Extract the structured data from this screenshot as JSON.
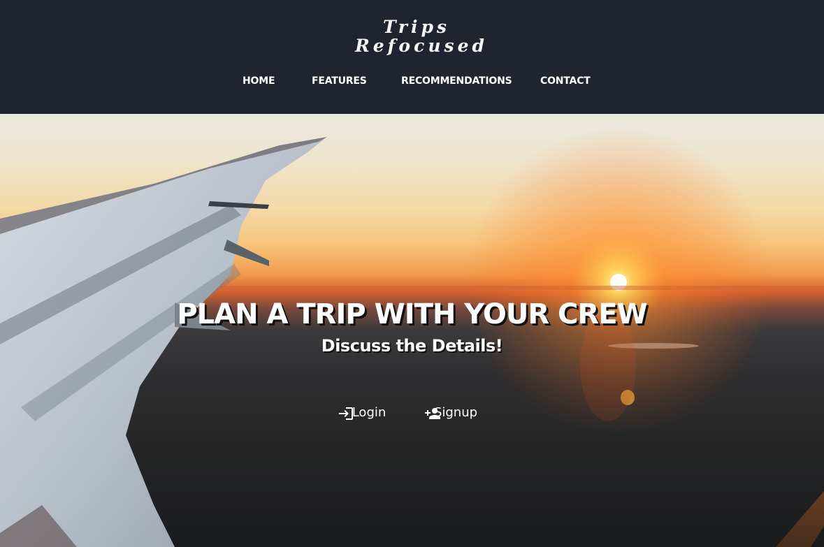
{
  "brand": {
    "line1": "Trips",
    "line2": "Refocused"
  },
  "nav": {
    "items": [
      {
        "label": "HOME"
      },
      {
        "label": "FEATURES"
      },
      {
        "label": "RECOMMENDATIONS"
      },
      {
        "label": "CONTACT"
      }
    ]
  },
  "hero": {
    "title": "PLAN A TRIP WITH YOUR CREW",
    "subtitle": "Discuss the Details!",
    "actions": [
      {
        "label": "Login",
        "icon": "login-icon"
      },
      {
        "label": "Signup",
        "icon": "person-add-icon"
      }
    ]
  },
  "colors": {
    "header_bg": "#202330",
    "text": "#ffffff"
  }
}
